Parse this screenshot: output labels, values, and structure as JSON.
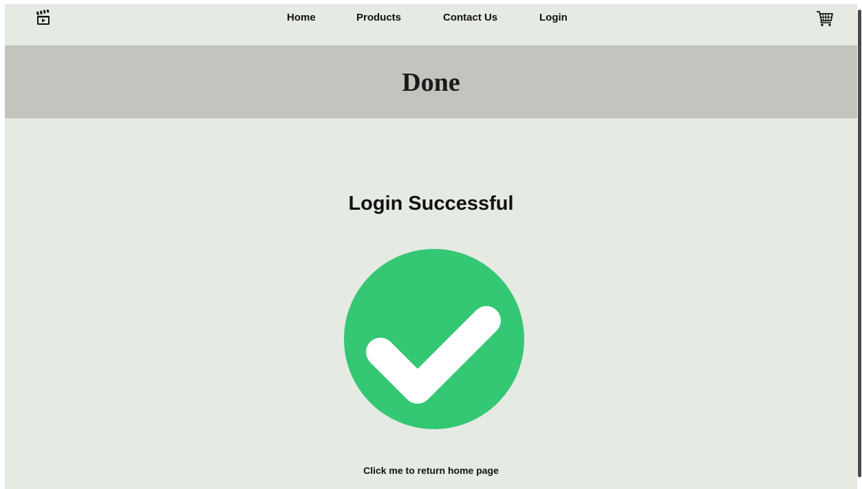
{
  "nav": {
    "logo_icon": "clapperboard-icon",
    "links": [
      "Home",
      "Products",
      "Contact Us",
      "Login"
    ],
    "cart_icon": "shopping-cart-icon"
  },
  "banner": {
    "title": "Done"
  },
  "main": {
    "headline": "Login Successful",
    "status_icon": "check-circle-icon",
    "return_link": "Click me to return home page"
  },
  "colors": {
    "page_bg": "#e5eae3",
    "banner_bg": "#c2c5bd",
    "success_green": "#34c774"
  }
}
